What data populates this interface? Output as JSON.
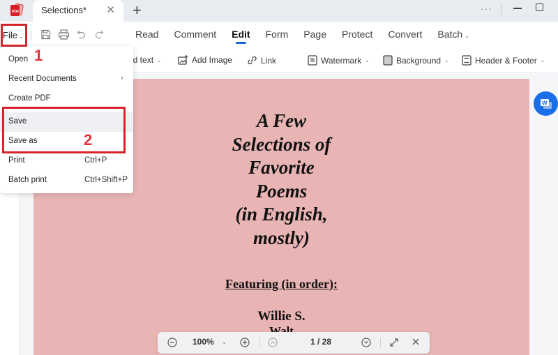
{
  "window": {
    "tab_title": "Selections*",
    "new_tab_symbol": "+",
    "close_tab_symbol": "✕",
    "more_symbol": "···"
  },
  "menubar": {
    "file_label": "File",
    "tabs": [
      {
        "label": "Read",
        "active": false
      },
      {
        "label": "Comment",
        "active": false
      },
      {
        "label": "Edit",
        "active": true
      },
      {
        "label": "Form",
        "active": false
      },
      {
        "label": "Page",
        "active": false
      },
      {
        "label": "Protect",
        "active": false
      },
      {
        "label": "Convert",
        "active": false
      },
      {
        "label": "Batch",
        "active": false,
        "has_dropdown": true
      }
    ]
  },
  "toolbar": {
    "items": [
      {
        "label": "Add text",
        "visible_label": "dd text",
        "icon": "text-icon",
        "has_dropdown": true
      },
      {
        "label": "Add Image",
        "icon": "image-icon"
      },
      {
        "label": "Link",
        "icon": "link-icon"
      },
      {
        "label": "Watermark",
        "icon": "watermark-icon",
        "has_dropdown": true
      },
      {
        "label": "Background",
        "icon": "background-icon",
        "has_dropdown": true
      },
      {
        "label": "Header & Footer",
        "icon": "header-footer-icon",
        "has_dropdown": true
      }
    ]
  },
  "file_menu": {
    "items": [
      {
        "label": "Open",
        "shortcut": ""
      },
      {
        "label": "Recent Documents",
        "shortcut": "",
        "submenu_arrow": "›"
      },
      {
        "label": "Create PDF",
        "shortcut": ""
      },
      {
        "label": "Save",
        "shortcut": "",
        "hovered": true
      },
      {
        "label": "Save as",
        "shortcut": ""
      },
      {
        "label": "Print",
        "shortcut": "Ctrl+P"
      },
      {
        "label": "Batch print",
        "shortcut": "Ctrl+Shift+P"
      }
    ]
  },
  "annotations": {
    "step1": "1",
    "step2": "2",
    "highlight_color": "#d5232b"
  },
  "document": {
    "title_lines": [
      "A Few",
      "Selections of",
      "Favorite",
      "Poems",
      "(in English,",
      "mostly)"
    ],
    "featuring": "Featuring (in order):",
    "author": "Willie S.",
    "author_partial": "Walt",
    "page_color": "#e8b4b4"
  },
  "bottom_bar": {
    "zoom": "100%",
    "current_page": "1",
    "page_separator": "/",
    "total_pages": "28",
    "page_display": "1 / 28"
  },
  "colors": {
    "accent": "#1a64d8",
    "word_button": "#1a6ee8"
  }
}
